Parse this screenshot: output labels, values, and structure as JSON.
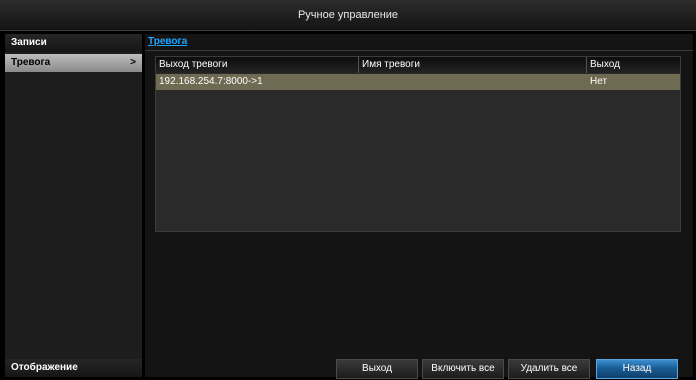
{
  "window": {
    "title": "Ручное управление"
  },
  "sidebar": {
    "header": "Записи",
    "items": [
      {
        "label": "Тревога",
        "arrow": ">"
      }
    ],
    "footer": "Отображение"
  },
  "breadcrumb": "Тревога",
  "table": {
    "headers": [
      "Выход тревоги",
      "Имя тревоги",
      "Выход"
    ],
    "rows": [
      [
        "192.168.254.7:8000->1",
        "",
        "Нет"
      ]
    ]
  },
  "buttons": {
    "exit": "Выход",
    "enable_all": "Включить все",
    "delete_all": "Удалить все",
    "back": "Назад"
  }
}
